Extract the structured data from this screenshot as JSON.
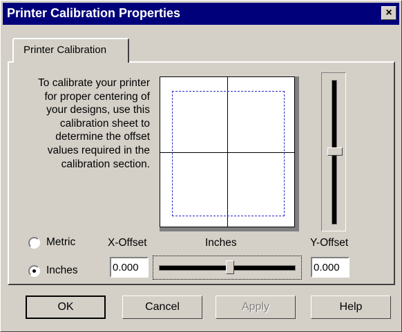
{
  "window": {
    "title": "Printer Calibration Properties",
    "close_glyph": "×"
  },
  "tabs": [
    {
      "label": "Printer Calibration",
      "selected": true
    }
  ],
  "description": "To calibrate your printer for proper centering of your designs, use this calibration sheet to determine the offset values required in the calibration section.",
  "units": {
    "metric_label": "Metric",
    "inches_label": "Inches",
    "selected": "Inches"
  },
  "offsets": {
    "x_label": "X-Offset",
    "y_label": "Y-Offset",
    "unit_label": "Inches",
    "x_value": "0.000",
    "y_value": "0.000"
  },
  "buttons": {
    "ok": "OK",
    "cancel": "Cancel",
    "apply": "Apply",
    "help": "Help"
  },
  "colors": {
    "titlebar": "#00007b",
    "dialog_face": "#d4d0c8",
    "calibration_dash": "#2424c8"
  }
}
